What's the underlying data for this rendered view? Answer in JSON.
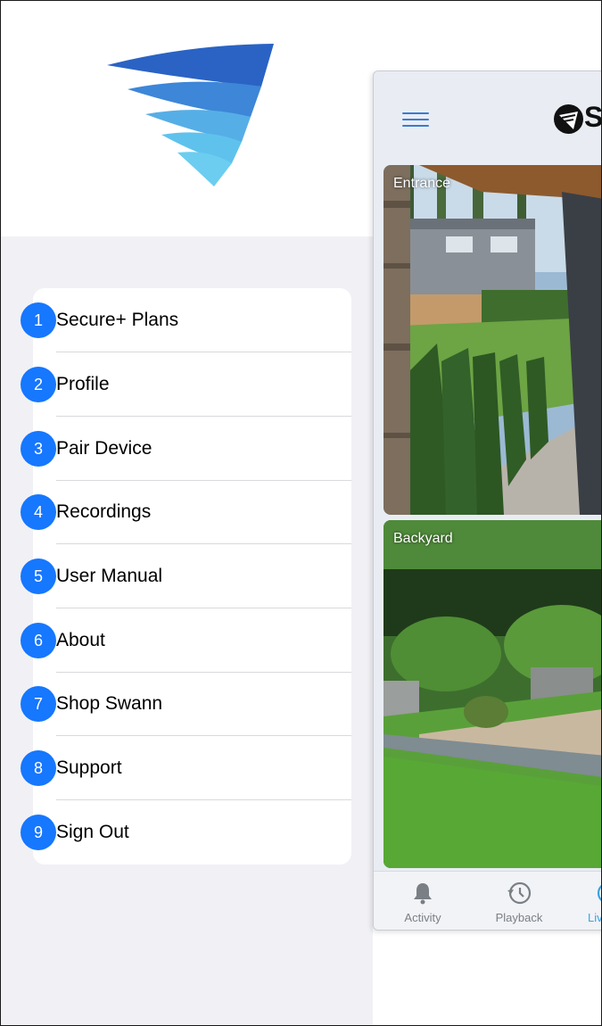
{
  "menu": {
    "items": [
      {
        "number": "1",
        "label": "Secure+ Plans"
      },
      {
        "number": "2",
        "label": "Profile"
      },
      {
        "number": "3",
        "label": "Pair Device"
      },
      {
        "number": "4",
        "label": "Recordings"
      },
      {
        "number": "5",
        "label": "User Manual"
      },
      {
        "number": "6",
        "label": "About"
      },
      {
        "number": "7",
        "label": "Shop Swann"
      },
      {
        "number": "8",
        "label": "Support"
      },
      {
        "number": "9",
        "label": "Sign Out"
      }
    ]
  },
  "preview": {
    "brand_text": "S",
    "cameras": [
      {
        "label": "Entrance"
      },
      {
        "label": "Backyard"
      }
    ],
    "tabs": [
      {
        "label": "Activity",
        "icon": "bell-icon"
      },
      {
        "label": "Playback",
        "icon": "history-icon"
      },
      {
        "label": "Liv",
        "icon": "live-icon",
        "active": true
      }
    ]
  },
  "colors": {
    "badge": "#1677ff",
    "logo_dark": "#2f66c7",
    "logo_light": "#5fc4ea",
    "active_tab": "#3aa3e0"
  }
}
